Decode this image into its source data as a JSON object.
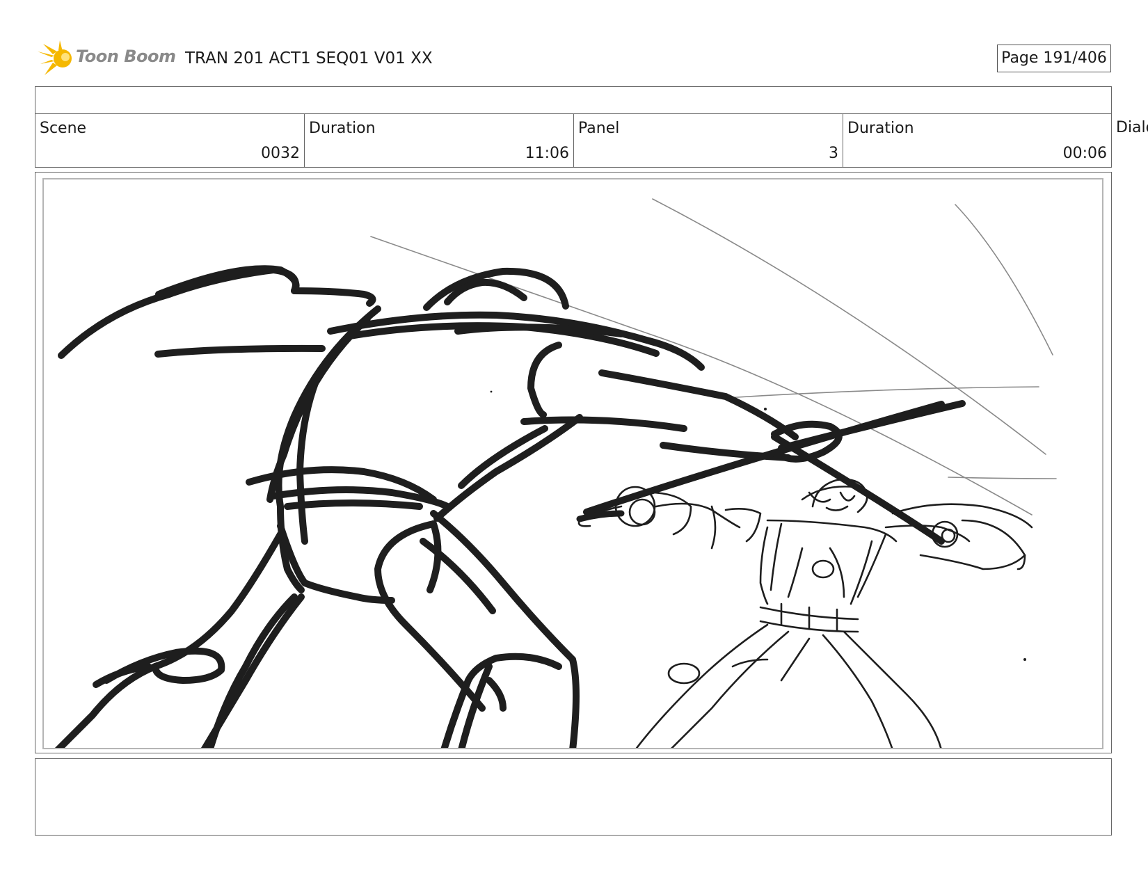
{
  "header": {
    "logo_text": "Toon Boom",
    "title": "TRAN 201 ACT1 SEQ01 V01 XX",
    "page": "Page 191/406"
  },
  "info": {
    "scene_label": "Scene",
    "scene_value": "0032",
    "scene_duration_label": "Duration",
    "scene_duration_value": "11:06",
    "panel_label": "Panel",
    "panel_value": "3",
    "panel_duration_label": "Duration",
    "panel_duration_value": "00:06",
    "dialog_label": "Dialo"
  },
  "colors": {
    "logo_star": "#f5b800",
    "logo_text": "#8a8a8a",
    "ink": "#1a1a1a"
  }
}
